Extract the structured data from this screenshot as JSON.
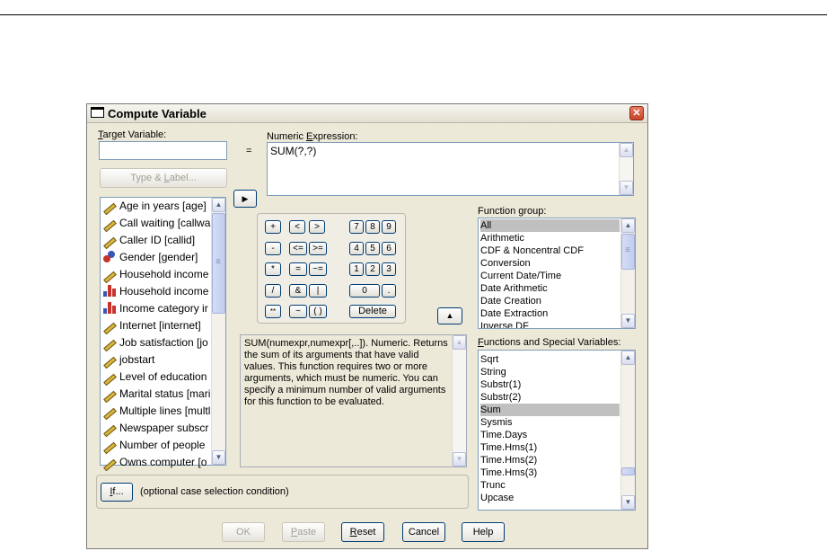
{
  "window": {
    "title": "Compute Variable",
    "close_glyph": "✕"
  },
  "target_variable": {
    "label_pre": "",
    "label_underline": "T",
    "label_post": "arget Variable:",
    "value": ""
  },
  "equals": "=",
  "type_label_button": {
    "pre": "Type & ",
    "underline": "L",
    "post": "abel..."
  },
  "numeric_expression": {
    "label_pre": "Numeric ",
    "label_underline": "E",
    "label_post": "xpression:",
    "value": "SUM(?,?)"
  },
  "variables": [
    {
      "label": "Age in years [age]",
      "icon": "ruler-icon"
    },
    {
      "label": "Call waiting [callwa",
      "icon": "ruler-icon"
    },
    {
      "label": "Caller ID [callid]",
      "icon": "ruler-icon"
    },
    {
      "label": "Gender [gender]",
      "icon": "gender-icon"
    },
    {
      "label": "Household income",
      "icon": "ruler-icon"
    },
    {
      "label": "Household income",
      "icon": "ordinal-bars-icon"
    },
    {
      "label": "Income category ir",
      "icon": "ordinal-bars-icon"
    },
    {
      "label": "Internet [internet]",
      "icon": "ruler-icon"
    },
    {
      "label": "Job satisfaction [jo",
      "icon": "ruler-icon"
    },
    {
      "label": "jobstart",
      "icon": "ruler-icon"
    },
    {
      "label": "Level of education",
      "icon": "ruler-icon"
    },
    {
      "label": "Marital status [mari",
      "icon": "ruler-icon"
    },
    {
      "label": "Multiple lines [multl",
      "icon": "ruler-icon"
    },
    {
      "label": "Newspaper subscr",
      "icon": "ruler-icon"
    },
    {
      "label": "Number of people",
      "icon": "ruler-icon"
    },
    {
      "label": "Owns computer [o",
      "icon": "ruler-icon"
    }
  ],
  "keypad": {
    "plus": "+",
    "less": "<",
    "greater": ">",
    "k7": "7",
    "k8": "8",
    "k9": "9",
    "minus": "-",
    "le": "<=",
    "ge": ">=",
    "k4": "4",
    "k5": "5",
    "k6": "6",
    "times": "*",
    "eq": "=",
    "ne": "~=",
    "k1": "1",
    "k2": "2",
    "k3": "3",
    "divide": "/",
    "and": "&",
    "or": "|",
    "k0": "0",
    "dot": ".",
    "power": "**",
    "not": "~",
    "parens": "( )",
    "delete": "Delete"
  },
  "description": "SUM(numexpr,numexpr[,..]). Numeric. Returns the sum of its arguments that have valid values. This function requires two or more arguments, which must be numeric. You can specify a minimum number of valid arguments for this function to be evaluated.",
  "function_group": {
    "label": "Function group:",
    "items": [
      "All",
      "Arithmetic",
      "CDF & Noncentral CDF",
      "Conversion",
      "Current Date/Time",
      "Date Arithmetic",
      "Date Creation",
      "Date Extraction",
      "Inverse DF"
    ],
    "selected": "All"
  },
  "functions": {
    "label_pre": "",
    "label_underline": "F",
    "label_post": "unctions and Special Variables:",
    "items": [
      "Sqrt",
      "String",
      "Substr(1)",
      "Substr(2)",
      "Sum",
      "Sysmis",
      "Time.Days",
      "Time.Hms(1)",
      "Time.Hms(2)",
      "Time.Hms(3)",
      "Trunc",
      "Upcase"
    ],
    "selected": "Sum"
  },
  "if_button": {
    "pre": "",
    "underline": "I",
    "post": "f..."
  },
  "if_caption": "(optional case selection condition)",
  "buttons": {
    "ok": "OK",
    "paste": {
      "underline": "P",
      "post": "aste"
    },
    "reset": {
      "underline": "R",
      "post": "eset"
    },
    "cancel": "Cancel",
    "help": "Help"
  }
}
